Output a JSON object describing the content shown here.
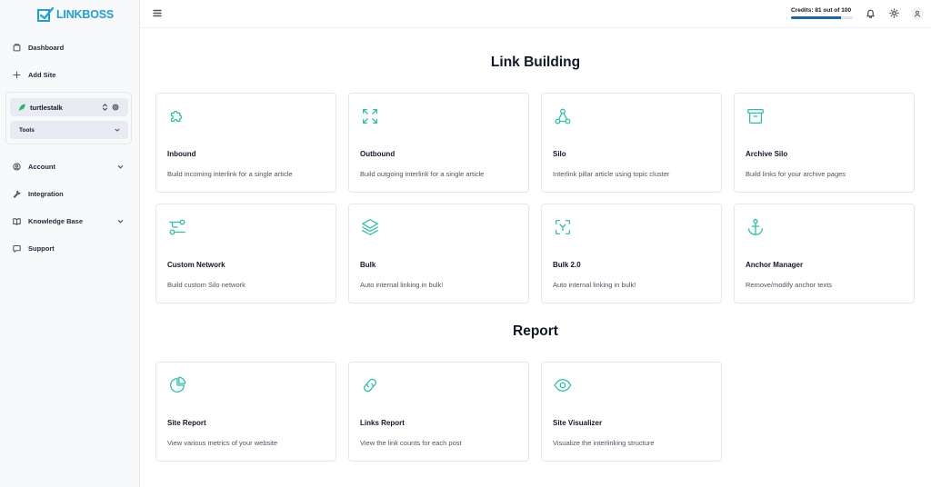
{
  "brand": {
    "name": "LINKBOSS",
    "color": "#1e9fd8",
    "accent": "#2bbfa8"
  },
  "sidebar": {
    "dashboard": "Dashboard",
    "add_site": "Add Site",
    "site_name": "turtlestalk",
    "tools": "Tools",
    "account": "Account",
    "integration": "Integration",
    "knowledge_base": "Knowledge Base",
    "support": "Support"
  },
  "topbar": {
    "credits_label": "Credits: 81 out of 100",
    "credits_used": 81,
    "credits_total": 100
  },
  "link_building": {
    "title": "Link Building",
    "cards": [
      {
        "icon": "puzzle-icon",
        "title": "Inbound",
        "desc": "Build incoming interlink for a single article"
      },
      {
        "icon": "expand-arrows-icon",
        "title": "Outbound",
        "desc": "Build outgoing interlink for a single article"
      },
      {
        "icon": "hierarchy-icon",
        "title": "Silo",
        "desc": "Interlink pillar article using topic cluster"
      },
      {
        "icon": "archive-box-icon",
        "title": "Archive Silo",
        "desc": "Build links for your archive pages"
      },
      {
        "icon": "network-nodes-icon",
        "title": "Custom Network",
        "desc": "Build custom Silo network"
      },
      {
        "icon": "layers-icon",
        "title": "Bulk",
        "desc": "Auto internal linking in bulk!"
      },
      {
        "icon": "scan-frame-icon",
        "title": "Bulk 2.0",
        "desc": "Auto internal linking in bulk!"
      },
      {
        "icon": "anchor-icon",
        "title": "Anchor Manager",
        "desc": "Remove/modify anchor texts"
      }
    ]
  },
  "report": {
    "title": "Report",
    "cards": [
      {
        "icon": "pie-chart-icon",
        "title": "Site Report",
        "desc": "View various metrics of your website"
      },
      {
        "icon": "link-icon",
        "title": "Links Report",
        "desc": "View the link counts for each post"
      },
      {
        "icon": "eye-icon",
        "title": "Site Visualizer",
        "desc": "Visualize the interlinking structure"
      }
    ]
  }
}
